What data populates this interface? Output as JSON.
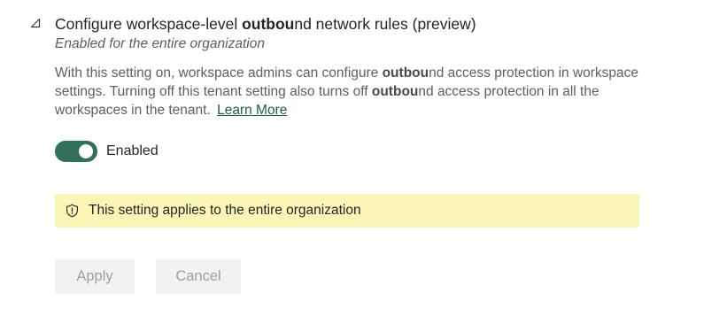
{
  "setting": {
    "title_prefix": "Configure workspace-level ",
    "title_bold": "outbou",
    "title_suffix": "nd network rules (preview)",
    "subtitle": "Enabled for the entire organization",
    "description": {
      "part1": "With this setting on, workspace admins can configure ",
      "bold1": "outbou",
      "part2": "nd access protection in workspace settings. Turning off this tenant setting also turns off ",
      "bold2": "outbou",
      "part3": "nd access protection in all the workspaces in the tenant. ",
      "link_label": "Learn More"
    },
    "toggle": {
      "state": "on",
      "label": "Enabled",
      "color": "#2f6f5b"
    },
    "banner": {
      "icon": "shield-icon",
      "text": "This setting applies to the entire organization",
      "background": "#fbf6b8"
    },
    "expander_icon": "collapse-triangle-icon"
  },
  "actions": {
    "apply_label": "Apply",
    "cancel_label": "Cancel"
  }
}
